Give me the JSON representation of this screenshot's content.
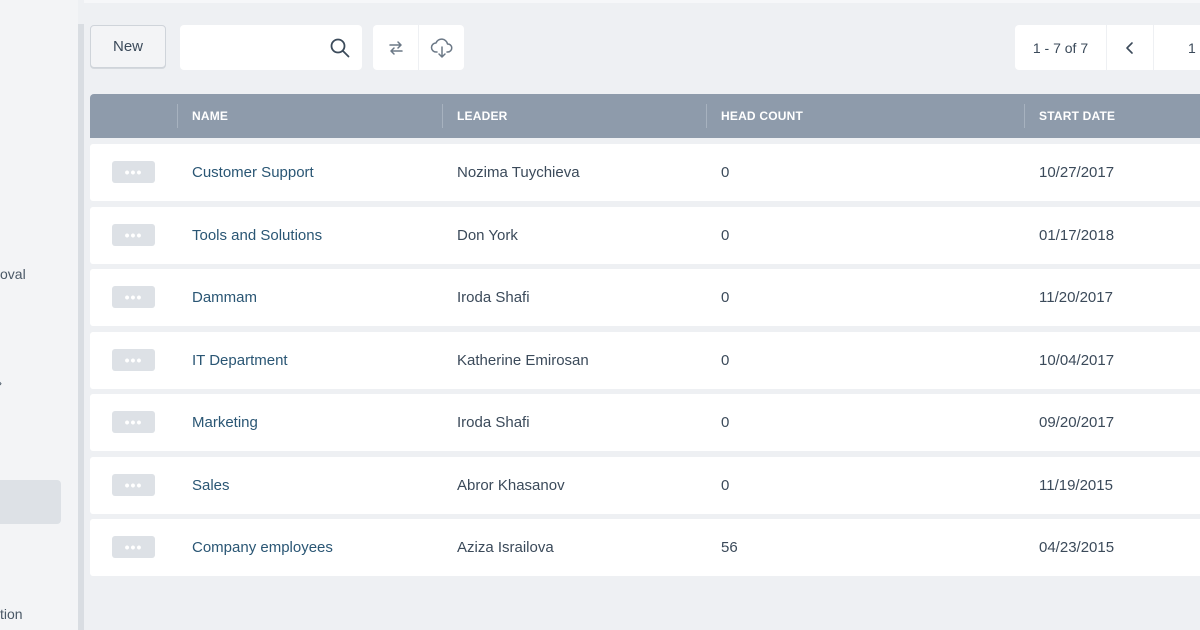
{
  "sidebar": {
    "partial_items": [
      "oval",
      "tion"
    ]
  },
  "toolbar": {
    "new_label": "New",
    "search_placeholder": "",
    "search_value": "",
    "icons": {
      "search": "search-icon",
      "refresh": "refresh-icon",
      "download": "cloud-download-icon"
    }
  },
  "pagination": {
    "range": "1 - 7 of 7",
    "current_page": "1"
  },
  "table": {
    "headers": {
      "name": "NAME",
      "leader": "LEADER",
      "head_count": "HEAD COUNT",
      "start_date": "START DATE"
    },
    "row_menu_label": "•••",
    "rows": [
      {
        "name": "Customer Support",
        "leader": "Nozima Tuychieva",
        "head_count": "0",
        "start_date": "10/27/2017"
      },
      {
        "name": "Tools and Solutions",
        "leader": "Don York",
        "head_count": "0",
        "start_date": "01/17/2018"
      },
      {
        "name": "Dammam",
        "leader": "Iroda Shafi",
        "head_count": "0",
        "start_date": "11/20/2017"
      },
      {
        "name": "IT Department",
        "leader": "Katherine Emirosan",
        "head_count": "0",
        "start_date": "10/04/2017"
      },
      {
        "name": "Marketing",
        "leader": "Iroda Shafi",
        "head_count": "0",
        "start_date": "09/20/2017"
      },
      {
        "name": "Sales",
        "leader": "Abror Khasanov",
        "head_count": "0",
        "start_date": "11/19/2015"
      },
      {
        "name": "Company employees",
        "leader": "Aziza Israilova",
        "head_count": "56",
        "start_date": "04/23/2015"
      }
    ]
  },
  "colors": {
    "header_bg": "#8e9bab",
    "link": "#2a5674",
    "page_bg": "#eef0f3"
  }
}
